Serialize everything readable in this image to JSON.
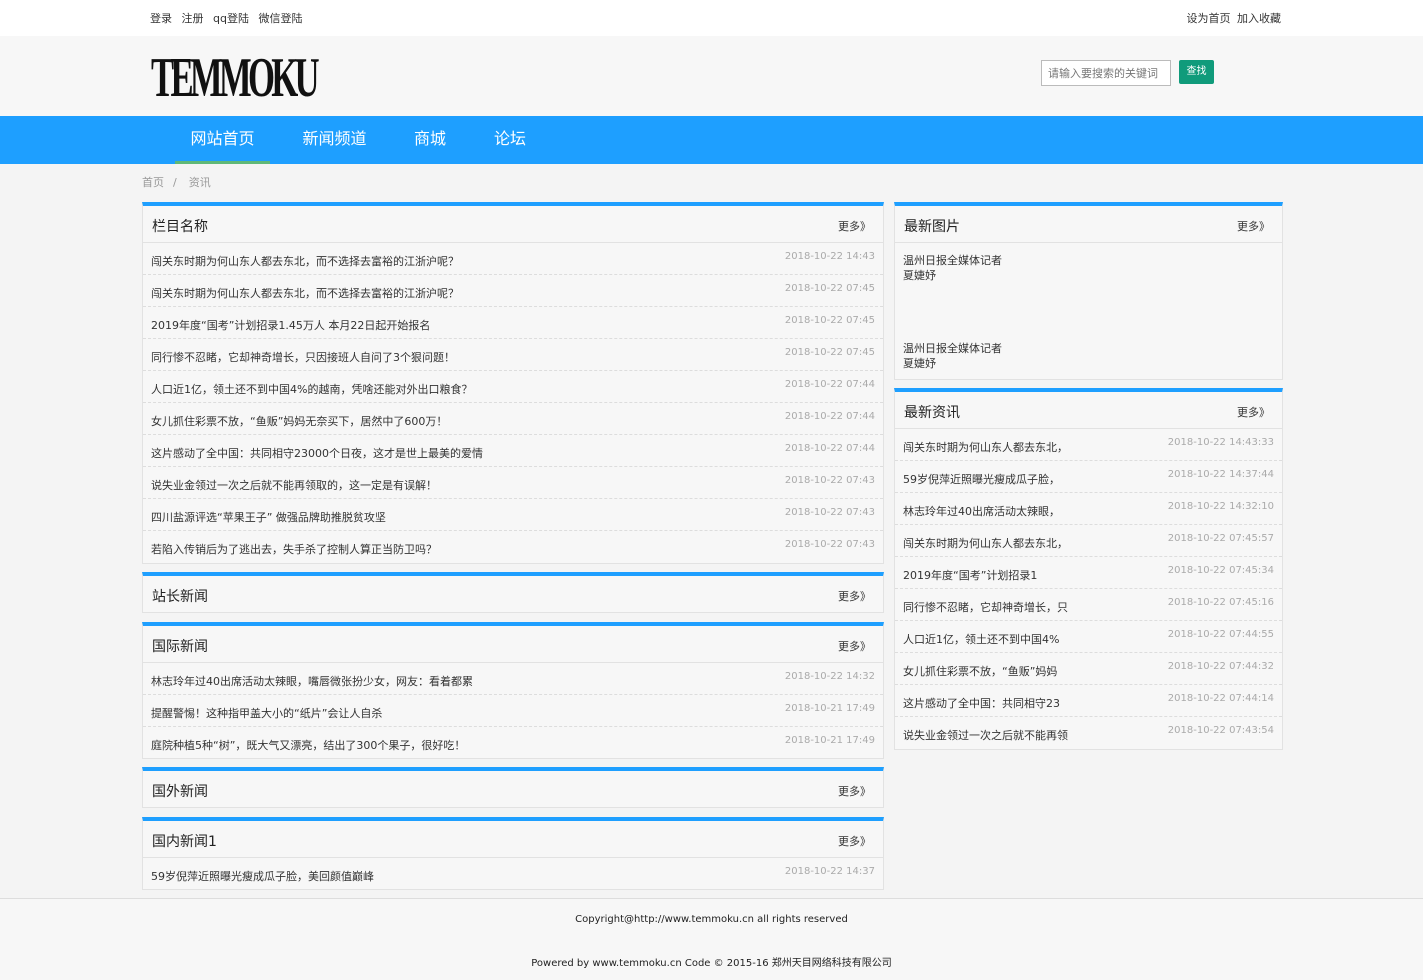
{
  "topbar": {
    "login": "登录",
    "register": "注册",
    "qq_login": "qq登陆",
    "wechat_login": "微信登陆",
    "set_home": "设为首页",
    "add_favorite": "加入收藏"
  },
  "header": {
    "logo": "TEMMOKU",
    "search_placeholder": "请输入要搜索的关键词",
    "search_button": "查找"
  },
  "nav": {
    "items": [
      {
        "label": "网站首页"
      },
      {
        "label": "新闻频道"
      },
      {
        "label": "商城"
      },
      {
        "label": "论坛"
      }
    ]
  },
  "breadcrumb": {
    "home": "首页",
    "separator": "/",
    "current": "资讯"
  },
  "more_label": "更多》",
  "main": {
    "column": {
      "title": "栏目名称",
      "rows": [
        {
          "title": "闯关东时期为何山东人都去东北，而不选择去富裕的江浙沪呢？",
          "date": "2018-10-22 14:43"
        },
        {
          "title": "闯关东时期为何山东人都去东北，而不选择去富裕的江浙沪呢？",
          "date": "2018-10-22 07:45"
        },
        {
          "title": "2019年度“国考”计划招录1.45万人 本月22日起开始报名",
          "date": "2018-10-22 07:45"
        },
        {
          "title": "同行惨不忍睹，它却神奇增长，只因接班人自问了3个狠问题！",
          "date": "2018-10-22 07:45"
        },
        {
          "title": "人口近1亿，领土还不到中国4%的越南，凭啥还能对外出口粮食？",
          "date": "2018-10-22 07:44"
        },
        {
          "title": "女儿抓住彩票不放，“鱼贩”妈妈无奈买下，居然中了600万！",
          "date": "2018-10-22 07:44"
        },
        {
          "title": "这片感动了全中国：共同相守23000个日夜，这才是世上最美的爱情",
          "date": "2018-10-22 07:44"
        },
        {
          "title": "说失业金领过一次之后就不能再领取的，这一定是有误解！",
          "date": "2018-10-22 07:43"
        },
        {
          "title": "四川盐源评选“苹果王子” 做强品牌助推脱贫攻坚",
          "date": "2018-10-22 07:43"
        },
        {
          "title": "若陷入传销后为了逃出去，失手杀了控制人算正当防卫吗？",
          "date": "2018-10-22 07:43"
        }
      ]
    },
    "webmaster": {
      "title": "站长新闻"
    },
    "international": {
      "title": "国际新闻",
      "rows": [
        {
          "title": "林志玲年过40出席活动太辣眼，嘴唇微张扮少女，网友：看着都累",
          "date": "2018-10-22 14:32"
        },
        {
          "title": "提醒警惕！这种指甲盖大小的“纸片”会让人自杀",
          "date": "2018-10-21 17:49"
        },
        {
          "title": "庭院种植5种“树”，既大气又漂亮，结出了300个果子，很好吃！",
          "date": "2018-10-21 17:49"
        }
      ]
    },
    "foreign": {
      "title": "国外新闻"
    },
    "domestic": {
      "title": "国内新闻1",
      "rows": [
        {
          "title": "59岁倪萍近照曝光瘦成瓜子脸，美回颜值巅峰",
          "date": "2018-10-22 14:37"
        }
      ]
    }
  },
  "sidebar": {
    "pictures": {
      "title": "最新图片",
      "items": [
        {
          "line1": "温州日报全媒体记者",
          "line2": "夏婕妤"
        },
        {
          "line1": "温州日报全媒体记者",
          "line2": "夏婕妤"
        }
      ]
    },
    "latest": {
      "title": "最新资讯",
      "rows": [
        {
          "title": "闯关东时期为何山东人都去东北，",
          "date": "2018-10-22 14:43:33"
        },
        {
          "title": "59岁倪萍近照曝光瘦成瓜子脸，",
          "date": "2018-10-22 14:37:44"
        },
        {
          "title": "林志玲年过40出席活动太辣眼，",
          "date": "2018-10-22 14:32:10"
        },
        {
          "title": "闯关东时期为何山东人都去东北，",
          "date": "2018-10-22 07:45:57"
        },
        {
          "title": "2019年度“国考”计划招录1",
          "date": "2018-10-22 07:45:34"
        },
        {
          "title": "同行惨不忍睹，它却神奇增长，只",
          "date": "2018-10-22 07:45:16"
        },
        {
          "title": "人口近1亿，领土还不到中国4%",
          "date": "2018-10-22 07:44:55"
        },
        {
          "title": "女儿抓住彩票不放，“鱼贩”妈妈",
          "date": "2018-10-22 07:44:32"
        },
        {
          "title": "这片感动了全中国：共同相守23",
          "date": "2018-10-22 07:44:14"
        },
        {
          "title": "说失业金领过一次之后就不能再领",
          "date": "2018-10-22 07:43:54"
        }
      ]
    }
  },
  "footer": {
    "copyright": "Copyright@http://www.temmoku.cn all rights reserved",
    "powered": "Powered by www.temmoku.cn Code © 2015-16 郑州天目网络科技有限公司"
  },
  "colors": {
    "nav_bg": "#1e9fff",
    "nav_active_underline": "#5fb878",
    "search_button": "#109b7b",
    "panel_top_border": "#1e9fff"
  }
}
